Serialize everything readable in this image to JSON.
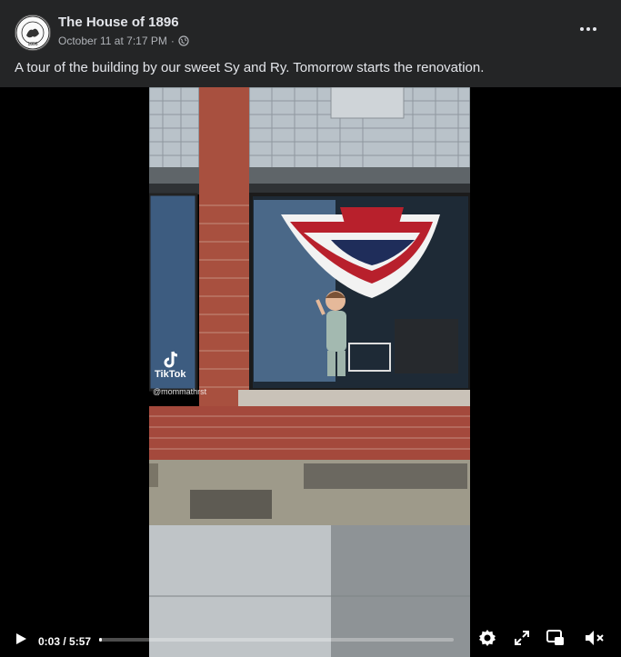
{
  "post": {
    "page_name": "The House of 1896",
    "timestamp": "October 11 at 7:17 PM",
    "separator": "·",
    "audience_icon": "globe-icon",
    "more_icon": "more-options-icon",
    "caption": "A tour of the building by our sweet Sy and Ry. Tomorrow starts the renovation.",
    "avatar_text_top": "THE HOUSE OF",
    "avatar_text_bottom": "1896"
  },
  "video": {
    "watermark": "TikTok",
    "watermark_handle": "@mommathrst",
    "current_time": "0:03",
    "duration": "5:57",
    "time_display": "0:03 / 5:57",
    "progress_fraction": 0.008,
    "icons": {
      "play": "play-icon",
      "settings": "gear-icon",
      "fullscreen": "expand-icon",
      "pip": "picture-in-picture-icon",
      "mute": "volume-muted-icon"
    }
  }
}
